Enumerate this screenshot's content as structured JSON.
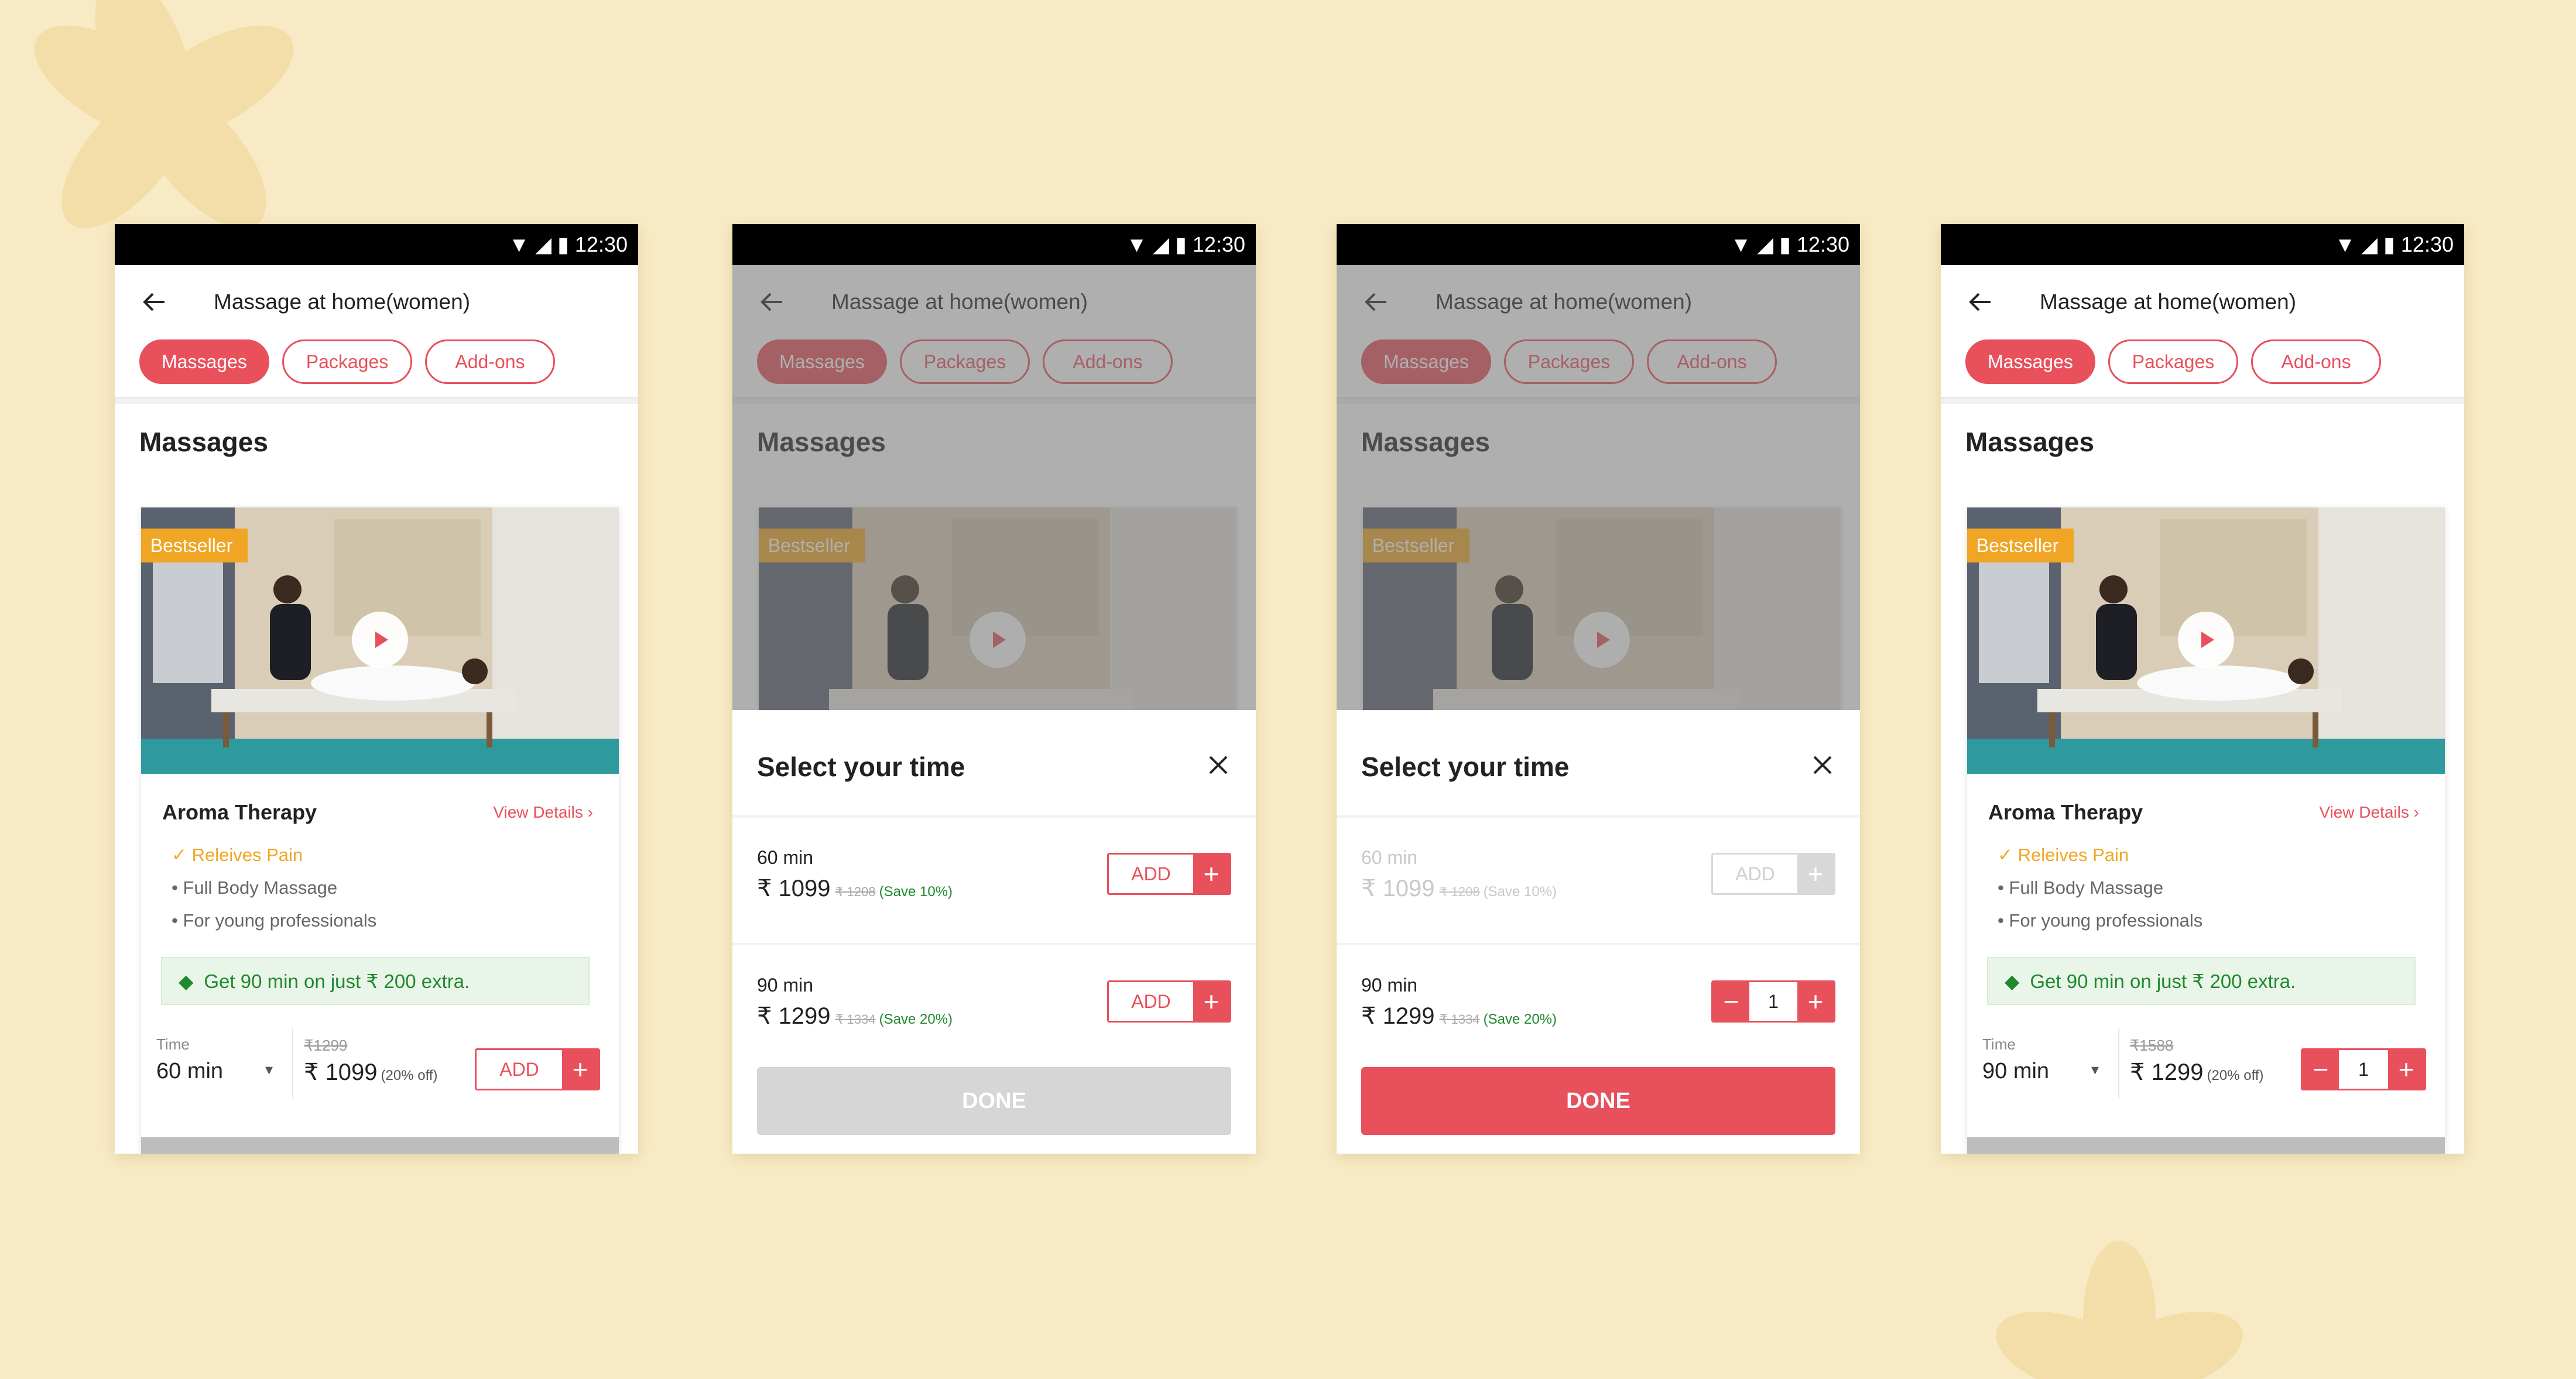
{
  "colors": {
    "background": "#f8eac4",
    "accent": "#e8505b",
    "badge": "#f0a624",
    "promo_green": "#1f8a2c"
  },
  "status": {
    "time": "12:30"
  },
  "header": {
    "title": "Massage at home(women)"
  },
  "tabs": [
    "Massages",
    "Packages",
    "Add-ons"
  ],
  "section": "Massages",
  "service": {
    "badge": "Bestseller",
    "name": "Aroma Therapy",
    "view_details": "View Details",
    "features": [
      "Releives Pain",
      "Full Body Massage",
      "For young professionals"
    ],
    "promo": "Get 90 min on just ₹ 200 extra.",
    "time_label": "Time"
  },
  "screen1": {
    "time": "60 min",
    "old_price": "₹1299",
    "price": "₹ 1099",
    "off": "(20% off)",
    "add_label": "ADD"
  },
  "screen4": {
    "time": "90 min",
    "old_price": "₹1588",
    "price": "₹ 1299",
    "off": "(20% off)",
    "qty": "1"
  },
  "sheet": {
    "title": "Select your time",
    "options": [
      {
        "duration": "60 min",
        "price": "₹ 1099",
        "old": "₹ 1208",
        "save": "(Save 10%)"
      },
      {
        "duration": "90 min",
        "price": "₹ 1299",
        "old": "₹ 1334",
        "save": "(Save 20%)"
      }
    ],
    "add_label": "ADD",
    "qty": "1",
    "done_label": "DONE"
  }
}
